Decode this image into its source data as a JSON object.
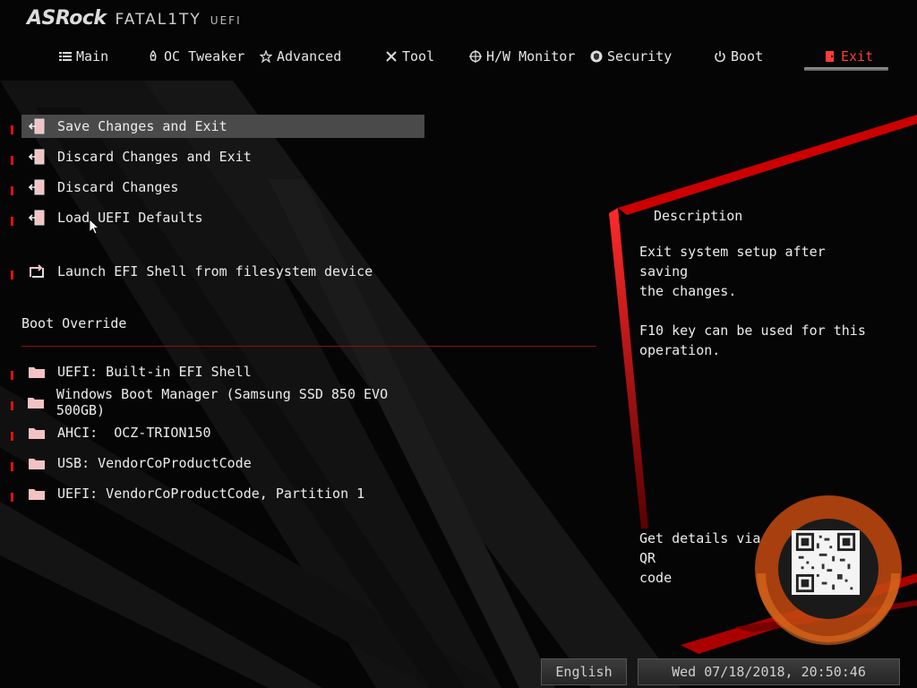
{
  "header": {
    "brand": "ASRock",
    "product": "FATAL1TY",
    "subtitle": "UEFI"
  },
  "nav": {
    "tabs": [
      {
        "label": "Main",
        "icon": "list-icon"
      },
      {
        "label": "OC Tweaker",
        "icon": "rocket-icon"
      },
      {
        "label": "Advanced",
        "icon": "star-icon"
      },
      {
        "label": "Tool",
        "icon": "tools-icon"
      },
      {
        "label": "H/W Monitor",
        "icon": "crosshair-icon"
      },
      {
        "label": "Security",
        "icon": "shield-icon"
      },
      {
        "label": "Boot",
        "icon": "power-icon"
      },
      {
        "label": "Exit",
        "icon": "exit-door-icon"
      }
    ],
    "active": "Exit"
  },
  "menu": {
    "items": [
      {
        "label": "Save Changes and Exit",
        "icon": "exit-door-icon"
      },
      {
        "label": "Discard Changes and Exit",
        "icon": "exit-door-icon"
      },
      {
        "label": "Discard Changes",
        "icon": "exit-door-icon"
      },
      {
        "label": "Load UEFI Defaults",
        "icon": "exit-door-icon"
      },
      {
        "label": "Launch EFI Shell from filesystem device",
        "icon": "launch-icon"
      }
    ],
    "selected": "Save Changes and Exit"
  },
  "boot_override": {
    "title": "Boot Override",
    "items": [
      {
        "label": "UEFI: Built-in EFI Shell",
        "icon": "folder-icon"
      },
      {
        "label": "Windows Boot Manager (Samsung SSD 850 EVO 500GB)",
        "icon": "folder-icon"
      },
      {
        "label": "AHCI:  OCZ-TRION150",
        "icon": "folder-icon"
      },
      {
        "label": "USB: VendorCoProductCode",
        "icon": "folder-icon"
      },
      {
        "label": "UEFI: VendorCoProductCode, Partition 1",
        "icon": "folder-icon"
      }
    ]
  },
  "description": {
    "title": "Description",
    "text": "Exit system setup after saving\nthe changes.\n\nF10 key can be used for this\noperation."
  },
  "qr": {
    "text": "Get details via QR\ncode"
  },
  "footer": {
    "language": "English",
    "datetime": "Wed 07/18/2018, 20:50:46"
  },
  "colors": {
    "accent": "#e01010",
    "background": "#050505",
    "text": "#ececec",
    "selection": "#4a4a4a"
  }
}
